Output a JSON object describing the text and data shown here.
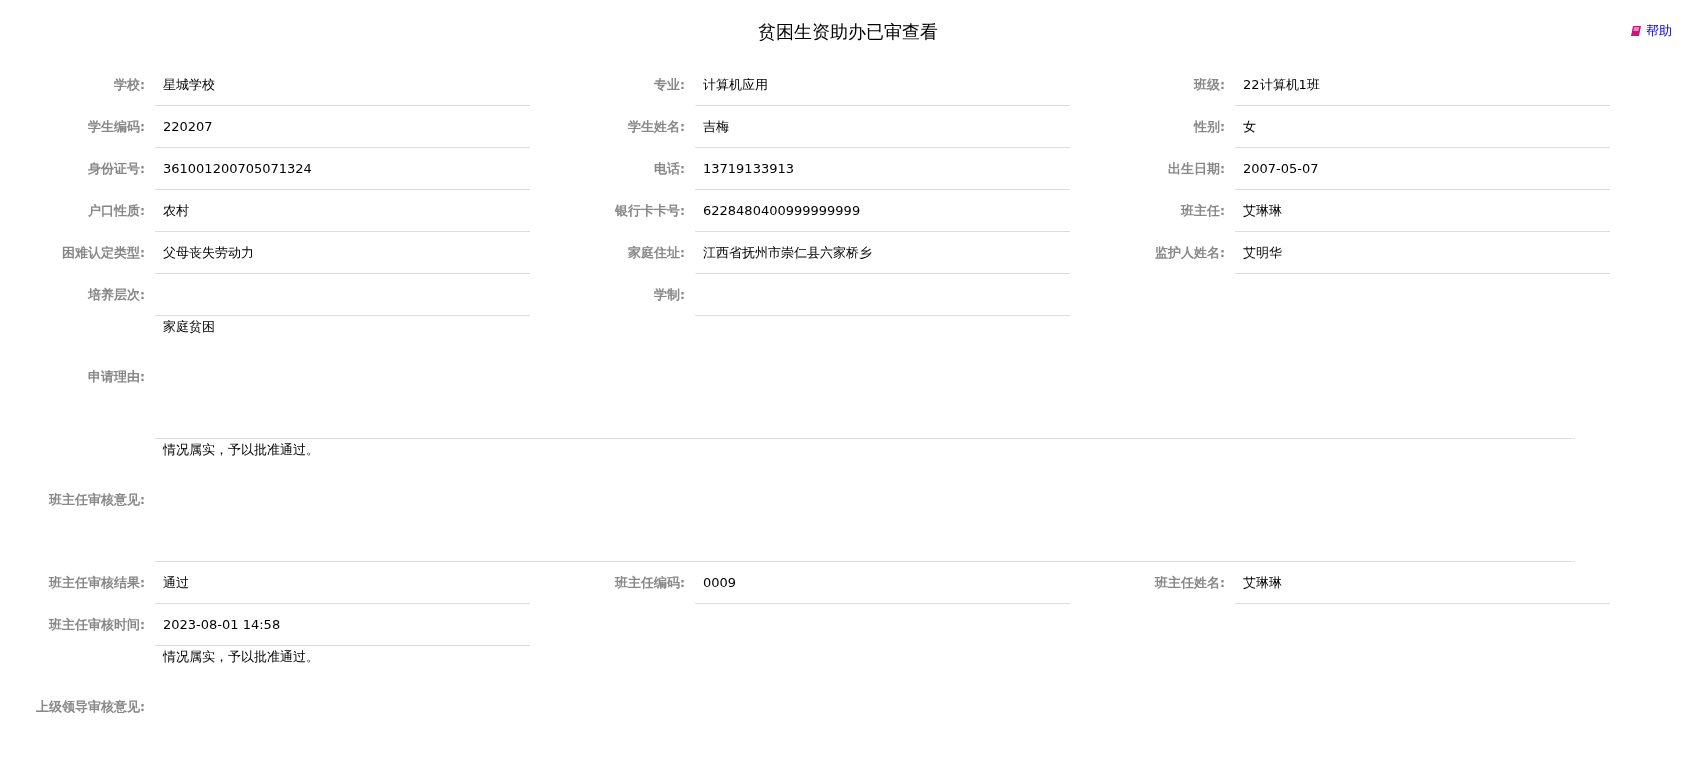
{
  "title": "贫困生资助办已审查看",
  "help": {
    "label": "帮助"
  },
  "sections": [
    {
      "kind": "fields",
      "fields": [
        {
          "label": "学校:",
          "value": "星城学校"
        },
        {
          "label": "专业:",
          "value": "计算机应用"
        },
        {
          "label": "班级:",
          "value": "22计算机1班"
        }
      ]
    },
    {
      "kind": "fields",
      "fields": [
        {
          "label": "学生编码:",
          "value": "220207"
        },
        {
          "label": "学生姓名:",
          "value": "吉梅"
        },
        {
          "label": "性别:",
          "value": "女"
        }
      ]
    },
    {
      "kind": "fields",
      "fields": [
        {
          "label": "身份证号:",
          "value": "361001200705071324"
        },
        {
          "label": "电话:",
          "value": "13719133913"
        },
        {
          "label": "出生日期:",
          "value": "2007-05-07"
        }
      ]
    },
    {
      "kind": "fields",
      "fields": [
        {
          "label": "户口性质:",
          "value": "农村"
        },
        {
          "label": "银行卡卡号:",
          "value": "6228480400999999999"
        },
        {
          "label": "班主任:",
          "value": "艾琳琳"
        }
      ]
    },
    {
      "kind": "fields",
      "fields": [
        {
          "label": "困难认定类型:",
          "value": "父母丧失劳动力"
        },
        {
          "label": "家庭住址:",
          "value": "江西省抚州市崇仁县六家桥乡"
        },
        {
          "label": "监护人姓名:",
          "value": "艾明华"
        }
      ]
    },
    {
      "kind": "fields",
      "fields": [
        {
          "label": "培养层次:"
        },
        {
          "label": "学制:"
        }
      ]
    },
    {
      "kind": "textarea",
      "label": "申请理由:",
      "value": "家庭贫困"
    },
    {
      "kind": "textarea",
      "label": "班主任审核意见:",
      "value": "情况属实，予以批准通过。"
    },
    {
      "kind": "fields",
      "fields": [
        {
          "label": "班主任审核结果:",
          "value": "通过"
        },
        {
          "label": "班主任编码:",
          "value": "0009"
        },
        {
          "label": "班主任姓名:",
          "value": "艾琳琳"
        }
      ]
    },
    {
      "kind": "fields",
      "fields": [
        {
          "label": "班主任审核时间:",
          "value": "2023-08-01 14:58"
        }
      ]
    },
    {
      "kind": "textarea",
      "label": "上级领导审核意见:",
      "value": "情况属实，予以批准通过。"
    }
  ]
}
